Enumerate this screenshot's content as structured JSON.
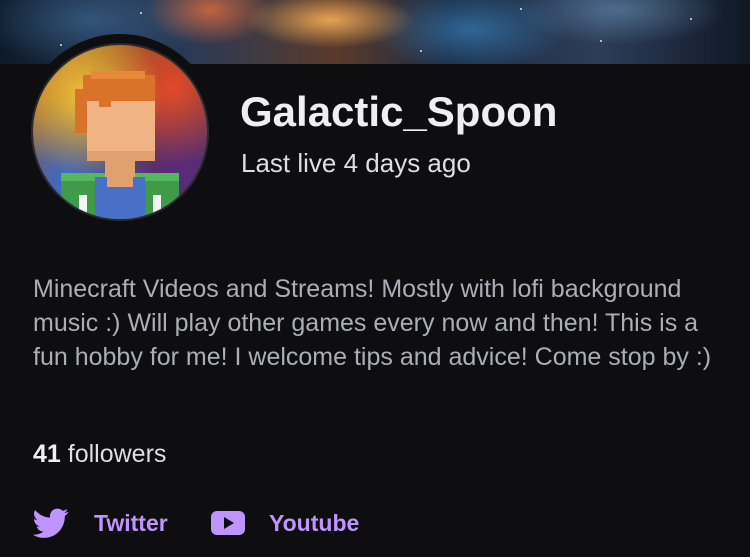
{
  "channel": {
    "name": "Galactic_Spoon",
    "last_live": "Last live 4 days ago",
    "bio": "Minecraft Videos and Streams! Mostly with lofi background music :) Will play other games every now and then! This is a fun hobby for me! I welcome tips and advice! Come stop by :)",
    "followers": {
      "count": "41",
      "label": "followers"
    }
  },
  "social_links": [
    {
      "label": "Twitter",
      "icon": "twitter-bird-icon"
    },
    {
      "label": "Youtube",
      "icon": "youtube-play-icon"
    }
  ],
  "colors": {
    "background": "#0e0e10",
    "text_primary": "#efeff1",
    "text_secondary": "#adadb8",
    "accent": "#bf94ff"
  }
}
